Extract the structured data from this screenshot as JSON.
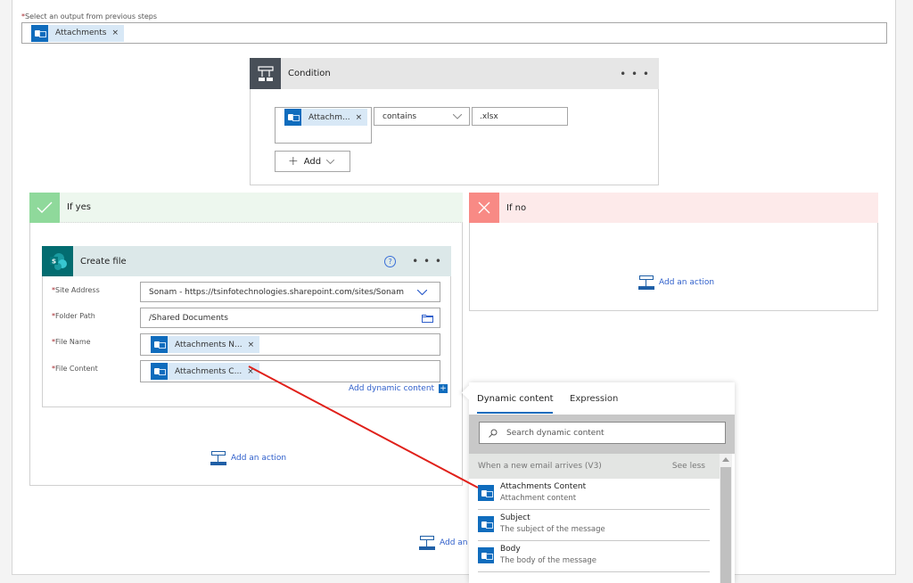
{
  "select_output": {
    "label": "Select an output from previous steps",
    "required_mark": "*",
    "token": {
      "label": "Attachments",
      "icon": "outlook-icon",
      "remove": "×"
    }
  },
  "condition": {
    "title": "Condition",
    "icon": "condition-icon",
    "more": "• • •",
    "row": {
      "token": {
        "label": "Attachm...",
        "icon": "outlook-icon",
        "remove": "×"
      },
      "operator": "contains",
      "value": ".xlsx"
    },
    "add_button": {
      "plus": "+",
      "label": "Add",
      "chevron": "chevron-down-icon"
    }
  },
  "if_yes": {
    "title": "If yes",
    "icon": "checkmark-icon",
    "color": "#8fd99b",
    "create_file": {
      "title": "Create file",
      "icon": "sharepoint-icon",
      "help": "?",
      "more": "• • •",
      "fields": [
        {
          "label": "Site Address",
          "required": "*",
          "value": "Sonam - https://tsinfotechnologies.sharepoint.com/sites/Sonam",
          "type": "dropdown"
        },
        {
          "label": "Folder Path",
          "required": "*",
          "value": "/Shared Documents",
          "type": "folder"
        },
        {
          "label": "File Name",
          "required": "*",
          "token": {
            "label": "Attachments N...",
            "remove": "×"
          }
        },
        {
          "label": "File Content",
          "required": "*",
          "token": {
            "label": "Attachments C...",
            "remove": "×"
          }
        }
      ],
      "add_dynamic": "Add dynamic content",
      "add_dynamic_icon": "+"
    },
    "add_action": "Add an action"
  },
  "if_no": {
    "title": "If no",
    "icon": "close-icon",
    "color": "#f88a85",
    "add_action": "Add an action"
  },
  "bottom_add_action": "Add an a",
  "dynamic_panel": {
    "tabs": [
      {
        "label": "Dynamic content",
        "active": true
      },
      {
        "label": "Expression",
        "active": false
      }
    ],
    "search_placeholder": "Search dynamic content",
    "section": {
      "title": "When a new email arrives (V3)",
      "toggle": "See less"
    },
    "items": [
      {
        "title": "Attachments Content",
        "subtitle": "Attachment content"
      },
      {
        "title": "Subject",
        "subtitle": "The subject of the message"
      },
      {
        "title": "Body",
        "subtitle": "The body of the message"
      }
    ]
  },
  "annotation": {
    "arrow_color": "#e0211b"
  }
}
